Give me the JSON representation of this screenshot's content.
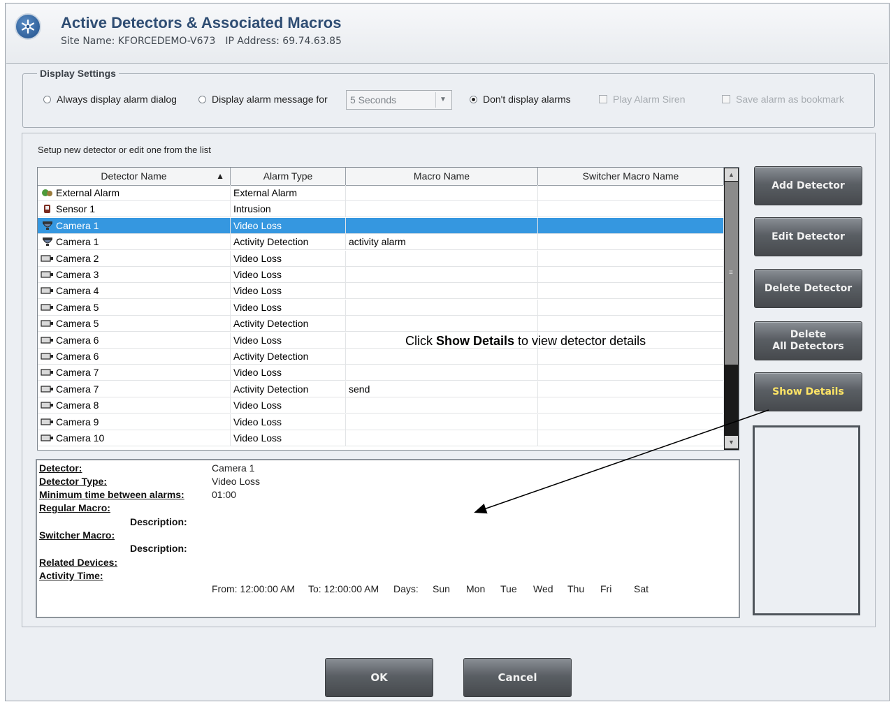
{
  "header": {
    "title": "Active Detectors & Associated Macros",
    "site_name": "Site Name: KFORCEDEMO-V673",
    "ip_address": "IP Address: 69.74.63.85"
  },
  "display_settings": {
    "legend": "Display Settings",
    "always_display": "Always display alarm dialog",
    "display_for": "Display alarm message for",
    "duration_value": "5 Seconds",
    "dont_display": "Don't display alarms",
    "play_siren": "Play Alarm Siren",
    "save_bookmark": "Save alarm as bookmark",
    "selected": "dont_display"
  },
  "hint": "Setup new detector or edit one from the  list",
  "columns": [
    "Detector Name",
    "Alarm Type",
    "Macro Name",
    "Switcher Macro Name"
  ],
  "rows": [
    {
      "icon": "external-alarm-icon",
      "name": "External Alarm",
      "type": "External Alarm",
      "macro": "",
      "switcher": ""
    },
    {
      "icon": "sensor-icon",
      "name": "Sensor  1",
      "type": "Intrusion",
      "macro": "",
      "switcher": ""
    },
    {
      "icon": "dome-camera-icon",
      "name": "Camera 1",
      "type": "Video Loss",
      "macro": "",
      "switcher": "",
      "selected": true
    },
    {
      "icon": "dome-camera-icon",
      "name": "Camera 1",
      "type": "Activity Detection",
      "macro": "activity alarm",
      "switcher": ""
    },
    {
      "icon": "camera-icon",
      "name": "Camera 2",
      "type": "Video Loss",
      "macro": "",
      "switcher": ""
    },
    {
      "icon": "camera-icon",
      "name": "Camera 3",
      "type": "Video Loss",
      "macro": "",
      "switcher": ""
    },
    {
      "icon": "camera-icon",
      "name": "Camera  4",
      "type": "Video Loss",
      "macro": "",
      "switcher": ""
    },
    {
      "icon": "camera-icon",
      "name": "Camera  5",
      "type": "Video Loss",
      "macro": "",
      "switcher": ""
    },
    {
      "icon": "camera-icon",
      "name": "Camera  5",
      "type": "Activity Detection",
      "macro": "",
      "switcher": ""
    },
    {
      "icon": "camera-icon",
      "name": "Camera  6",
      "type": "Video Loss",
      "macro": "",
      "switcher": ""
    },
    {
      "icon": "camera-icon",
      "name": "Camera  6",
      "type": "Activity Detection",
      "macro": "",
      "switcher": ""
    },
    {
      "icon": "camera-icon",
      "name": "Camera  7",
      "type": "Video Loss",
      "macro": "",
      "switcher": ""
    },
    {
      "icon": "camera-icon",
      "name": "Camera  7",
      "type": "Activity Detection",
      "macro": "send",
      "switcher": ""
    },
    {
      "icon": "camera-icon",
      "name": "Camera  8",
      "type": "Video Loss",
      "macro": "",
      "switcher": ""
    },
    {
      "icon": "camera-icon",
      "name": "Camera  9",
      "type": "Video Loss",
      "macro": "",
      "switcher": ""
    },
    {
      "icon": "camera-icon",
      "name": "Camera 10",
      "type": "Video Loss",
      "macro": "",
      "switcher": ""
    }
  ],
  "callout": {
    "prefix": "Click ",
    "bold": "Show Details",
    "suffix": " to view detector details"
  },
  "details": {
    "detector_label": "Detector:",
    "detector_value": "Camera 1",
    "type_label": "Detector Type:",
    "type_value": "Video Loss",
    "min_time_label": "Minimum time between alarms:",
    "min_time_value": "01:00",
    "regular_macro_label": "Regular Macro:",
    "description_label": "Description:",
    "switcher_macro_label": "Switcher Macro:",
    "related_devices_label": "Related Devices:",
    "activity_time_label": "Activity Time:",
    "from_text": "From: 12:00:00 AM",
    "to_text": "To: 12:00:00 AM",
    "days_label": "Days:",
    "days": [
      "Sun",
      "Mon",
      "Tue",
      "Wed",
      "Thu",
      "Fri",
      "Sat"
    ]
  },
  "buttons": {
    "add": "Add Detector",
    "edit": "Edit Detector",
    "delete": "Delete Detector",
    "delete_all_1": "Delete",
    "delete_all_2": "All Detectors",
    "show_details": "Show Details",
    "ok": "OK",
    "cancel": "Cancel"
  },
  "colors": {
    "selection": "#3597e0",
    "show_details_text": "#ffe566",
    "title": "#2f4d73"
  }
}
